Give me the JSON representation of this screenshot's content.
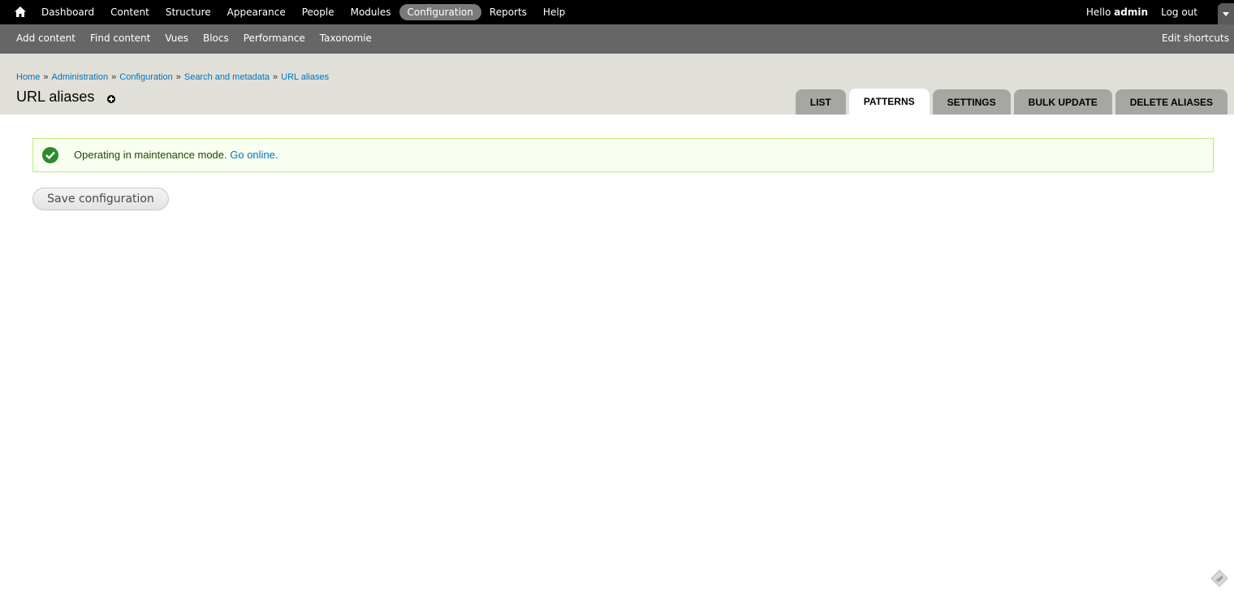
{
  "toolbar": {
    "menu": [
      {
        "label": "Dashboard",
        "active": false
      },
      {
        "label": "Content",
        "active": false
      },
      {
        "label": "Structure",
        "active": false
      },
      {
        "label": "Appearance",
        "active": false
      },
      {
        "label": "People",
        "active": false
      },
      {
        "label": "Modules",
        "active": false
      },
      {
        "label": "Configuration",
        "active": true
      },
      {
        "label": "Reports",
        "active": false
      },
      {
        "label": "Help",
        "active": false
      }
    ],
    "hello": "Hello",
    "username": "admin",
    "logout": "Log out",
    "home_icon": "home-icon",
    "toggle_icon": "chevron-down-icon"
  },
  "shortcuts": {
    "items": [
      "Add content",
      "Find content",
      "Vues",
      "Blocs",
      "Performance",
      "Taxonomie"
    ],
    "edit": "Edit shortcuts"
  },
  "breadcrumb": [
    "Home",
    "Administration",
    "Configuration",
    "Search and metadata",
    "URL aliases"
  ],
  "breadcrumb_separator": "»",
  "page": {
    "title": "URL aliases"
  },
  "tabs": [
    {
      "label": "List",
      "active": false
    },
    {
      "label": "Patterns",
      "active": true
    },
    {
      "label": "Settings",
      "active": false
    },
    {
      "label": "Bulk update",
      "active": false
    },
    {
      "label": "Delete aliases",
      "active": false
    }
  ],
  "message": {
    "text": "Operating in maintenance mode.",
    "link": "Go online."
  },
  "form": {
    "save_label": "Save configuration"
  },
  "colors": {
    "toolbar_bg": "#000000",
    "shortcuts_bg": "#666666",
    "header_bg": "#e0e0d8",
    "link": "#0074bd",
    "status_ok_bg": "#f8fff0",
    "status_ok_border": "#bbee77"
  }
}
